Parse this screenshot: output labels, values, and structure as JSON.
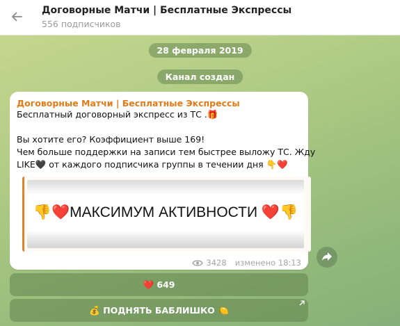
{
  "header": {
    "title": "Договорные Матчи | Бесплатные Экспрессы",
    "subscribers": "556 подписчиков"
  },
  "service": {
    "date": "28 февраля 2019",
    "created": "Канал создан"
  },
  "message": {
    "sender": "Договорные Матчи | Бесплатные Экспрессы",
    "line1": "Бесплатный договорный экспресс из ТС .🎁",
    "line2": "Вы хотите его? Коэффициент выше 169!",
    "line3": "Чем больше поддержки на записи тем быстрее выложу ТС. Жду",
    "line4": "LIKE🖤 от каждого подписчика группы в течении дня 👇❤️",
    "preview_text": "👎❤️МАКСИМУМ АКТИВНОСТИ ❤️👎",
    "views": "3428",
    "edited": "изменено 18:13"
  },
  "buttons": {
    "likes": "❤️ 649",
    "raise": "💰 ПОДНЯТЬ БАБЛИШКО 🍋"
  },
  "icons": {
    "back": "arrow-left-icon",
    "views": "eye-icon",
    "share": "share-arrow-icon",
    "external": "external-link-icon"
  },
  "colors": {
    "sender": "#e17b17",
    "accent": "#e1832d"
  }
}
